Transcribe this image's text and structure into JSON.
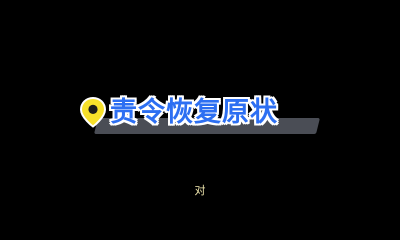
{
  "title": {
    "text": "责令恢复原状",
    "color": "#2d6ff2",
    "stroke_color": "#ffffff",
    "icon": "location-pin-icon",
    "icon_color": "#f7e02a"
  },
  "subtitle": {
    "text": "对",
    "color": "#f2e9b0"
  },
  "background_color": "#000000"
}
